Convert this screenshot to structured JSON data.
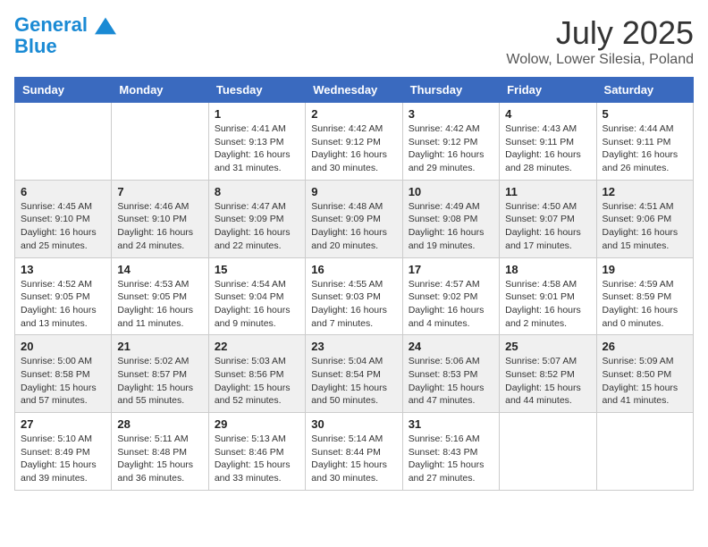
{
  "logo": {
    "line1": "General",
    "line2": "Blue"
  },
  "title": "July 2025",
  "location": "Wolow, Lower Silesia, Poland",
  "weekdays": [
    "Sunday",
    "Monday",
    "Tuesday",
    "Wednesday",
    "Thursday",
    "Friday",
    "Saturday"
  ],
  "weeks": [
    [
      {
        "day": "",
        "info": ""
      },
      {
        "day": "",
        "info": ""
      },
      {
        "day": "1",
        "info": "Sunrise: 4:41 AM\nSunset: 9:13 PM\nDaylight: 16 hours and 31 minutes."
      },
      {
        "day": "2",
        "info": "Sunrise: 4:42 AM\nSunset: 9:12 PM\nDaylight: 16 hours and 30 minutes."
      },
      {
        "day": "3",
        "info": "Sunrise: 4:42 AM\nSunset: 9:12 PM\nDaylight: 16 hours and 29 minutes."
      },
      {
        "day": "4",
        "info": "Sunrise: 4:43 AM\nSunset: 9:11 PM\nDaylight: 16 hours and 28 minutes."
      },
      {
        "day": "5",
        "info": "Sunrise: 4:44 AM\nSunset: 9:11 PM\nDaylight: 16 hours and 26 minutes."
      }
    ],
    [
      {
        "day": "6",
        "info": "Sunrise: 4:45 AM\nSunset: 9:10 PM\nDaylight: 16 hours and 25 minutes."
      },
      {
        "day": "7",
        "info": "Sunrise: 4:46 AM\nSunset: 9:10 PM\nDaylight: 16 hours and 24 minutes."
      },
      {
        "day": "8",
        "info": "Sunrise: 4:47 AM\nSunset: 9:09 PM\nDaylight: 16 hours and 22 minutes."
      },
      {
        "day": "9",
        "info": "Sunrise: 4:48 AM\nSunset: 9:09 PM\nDaylight: 16 hours and 20 minutes."
      },
      {
        "day": "10",
        "info": "Sunrise: 4:49 AM\nSunset: 9:08 PM\nDaylight: 16 hours and 19 minutes."
      },
      {
        "day": "11",
        "info": "Sunrise: 4:50 AM\nSunset: 9:07 PM\nDaylight: 16 hours and 17 minutes."
      },
      {
        "day": "12",
        "info": "Sunrise: 4:51 AM\nSunset: 9:06 PM\nDaylight: 16 hours and 15 minutes."
      }
    ],
    [
      {
        "day": "13",
        "info": "Sunrise: 4:52 AM\nSunset: 9:05 PM\nDaylight: 16 hours and 13 minutes."
      },
      {
        "day": "14",
        "info": "Sunrise: 4:53 AM\nSunset: 9:05 PM\nDaylight: 16 hours and 11 minutes."
      },
      {
        "day": "15",
        "info": "Sunrise: 4:54 AM\nSunset: 9:04 PM\nDaylight: 16 hours and 9 minutes."
      },
      {
        "day": "16",
        "info": "Sunrise: 4:55 AM\nSunset: 9:03 PM\nDaylight: 16 hours and 7 minutes."
      },
      {
        "day": "17",
        "info": "Sunrise: 4:57 AM\nSunset: 9:02 PM\nDaylight: 16 hours and 4 minutes."
      },
      {
        "day": "18",
        "info": "Sunrise: 4:58 AM\nSunset: 9:01 PM\nDaylight: 16 hours and 2 minutes."
      },
      {
        "day": "19",
        "info": "Sunrise: 4:59 AM\nSunset: 8:59 PM\nDaylight: 16 hours and 0 minutes."
      }
    ],
    [
      {
        "day": "20",
        "info": "Sunrise: 5:00 AM\nSunset: 8:58 PM\nDaylight: 15 hours and 57 minutes."
      },
      {
        "day": "21",
        "info": "Sunrise: 5:02 AM\nSunset: 8:57 PM\nDaylight: 15 hours and 55 minutes."
      },
      {
        "day": "22",
        "info": "Sunrise: 5:03 AM\nSunset: 8:56 PM\nDaylight: 15 hours and 52 minutes."
      },
      {
        "day": "23",
        "info": "Sunrise: 5:04 AM\nSunset: 8:54 PM\nDaylight: 15 hours and 50 minutes."
      },
      {
        "day": "24",
        "info": "Sunrise: 5:06 AM\nSunset: 8:53 PM\nDaylight: 15 hours and 47 minutes."
      },
      {
        "day": "25",
        "info": "Sunrise: 5:07 AM\nSunset: 8:52 PM\nDaylight: 15 hours and 44 minutes."
      },
      {
        "day": "26",
        "info": "Sunrise: 5:09 AM\nSunset: 8:50 PM\nDaylight: 15 hours and 41 minutes."
      }
    ],
    [
      {
        "day": "27",
        "info": "Sunrise: 5:10 AM\nSunset: 8:49 PM\nDaylight: 15 hours and 39 minutes."
      },
      {
        "day": "28",
        "info": "Sunrise: 5:11 AM\nSunset: 8:48 PM\nDaylight: 15 hours and 36 minutes."
      },
      {
        "day": "29",
        "info": "Sunrise: 5:13 AM\nSunset: 8:46 PM\nDaylight: 15 hours and 33 minutes."
      },
      {
        "day": "30",
        "info": "Sunrise: 5:14 AM\nSunset: 8:44 PM\nDaylight: 15 hours and 30 minutes."
      },
      {
        "day": "31",
        "info": "Sunrise: 5:16 AM\nSunset: 8:43 PM\nDaylight: 15 hours and 27 minutes."
      },
      {
        "day": "",
        "info": ""
      },
      {
        "day": "",
        "info": ""
      }
    ]
  ]
}
